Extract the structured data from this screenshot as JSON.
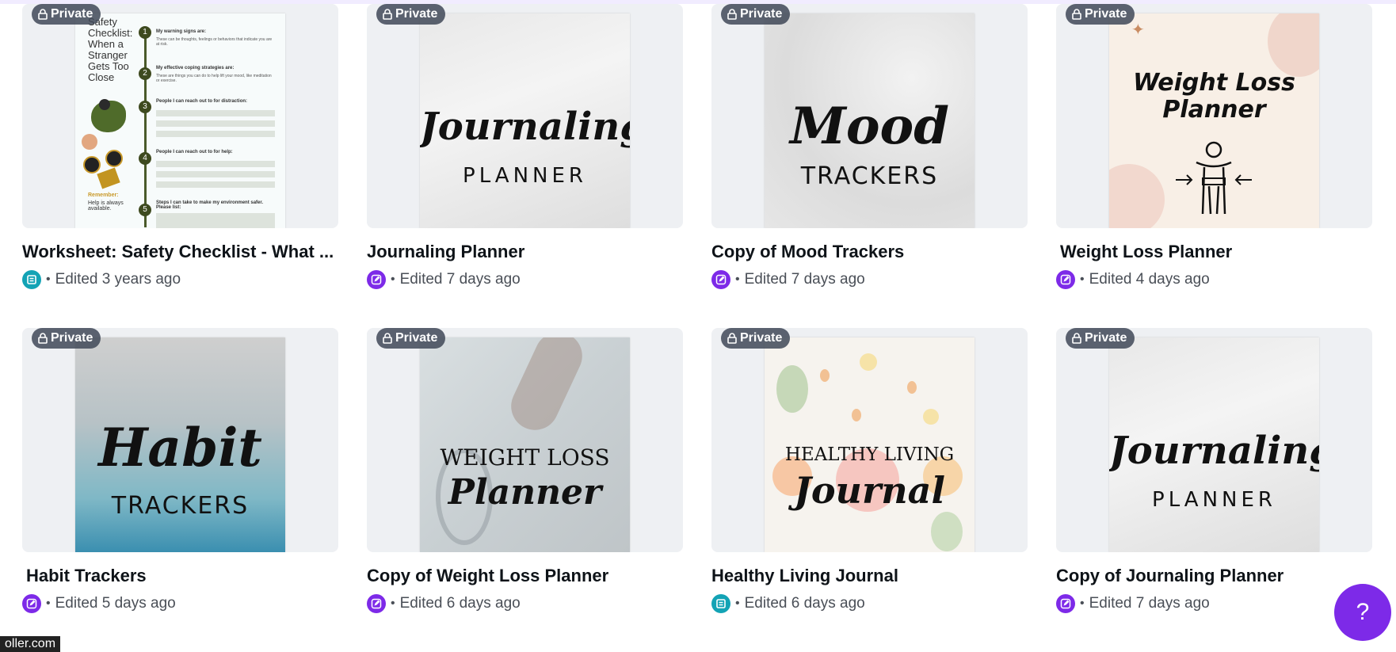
{
  "designs": [
    {
      "title": "Worksheet: Safety Checklist - What ...",
      "badge": "Private",
      "edited": "Edited 3 years ago",
      "app": "doc",
      "thumb": {
        "heading": "Safety Checklist: When a Stranger Gets Too Close",
        "sections": [
          "My warning signs are:",
          "My effective coping strategies are:",
          "People I can reach out to for distraction:",
          "People I can reach out to for help:",
          "Steps I can take to make my environment safer. Please list:"
        ],
        "notes": [
          "These can be thoughts, feelings or behaviors that indicate you are at risk.",
          "These are things you can do to help lift your mood, like meditation or exercise."
        ],
        "footer_label": "Remember:",
        "footer_text": "Help is always available."
      }
    },
    {
      "title": "Journaling Planner",
      "badge": "Private",
      "edited": "Edited 7 days ago",
      "app": "design",
      "thumb": {
        "line1": "Journaling",
        "line2": "PLANNER"
      }
    },
    {
      "title": "Copy of Mood Trackers",
      "badge": "Private",
      "edited": "Edited 7 days ago",
      "app": "design",
      "thumb": {
        "line1": "Mood",
        "line2": "TRACKERS"
      }
    },
    {
      "title": "Weight Loss Planner",
      "badge": "Private",
      "edited": "Edited 4 days ago",
      "app": "design",
      "thumb": {
        "line1": "Weight Loss",
        "line2": "Planner"
      }
    },
    {
      "title": "Habit Trackers",
      "badge": "Private",
      "edited": "Edited 5 days ago",
      "app": "design",
      "thumb": {
        "line1": "Habit",
        "line2": "TRACKERS"
      }
    },
    {
      "title": "Copy of Weight Loss Planner",
      "badge": "Private",
      "edited": "Edited 6 days ago",
      "app": "design",
      "thumb": {
        "line1": "WEIGHT LOSS",
        "line2": "Planner"
      }
    },
    {
      "title": "Healthy Living Journal",
      "badge": "Private",
      "edited": "Edited 6 days ago",
      "app": "doc",
      "thumb": {
        "line1": "HEALTHY LIVING",
        "line2": "Journal"
      }
    },
    {
      "title": "Copy of Journaling Planner",
      "badge": "Private",
      "edited": "Edited 7 days ago",
      "app": "design",
      "thumb": {
        "line1": "Journaling",
        "line2": "PLANNER"
      }
    }
  ],
  "help_button": "?",
  "status_pill": "oller.com",
  "colors": {
    "accent": "#7d2ae8",
    "doc_icon": "#13a3b5",
    "badge_bg": "#404857"
  }
}
